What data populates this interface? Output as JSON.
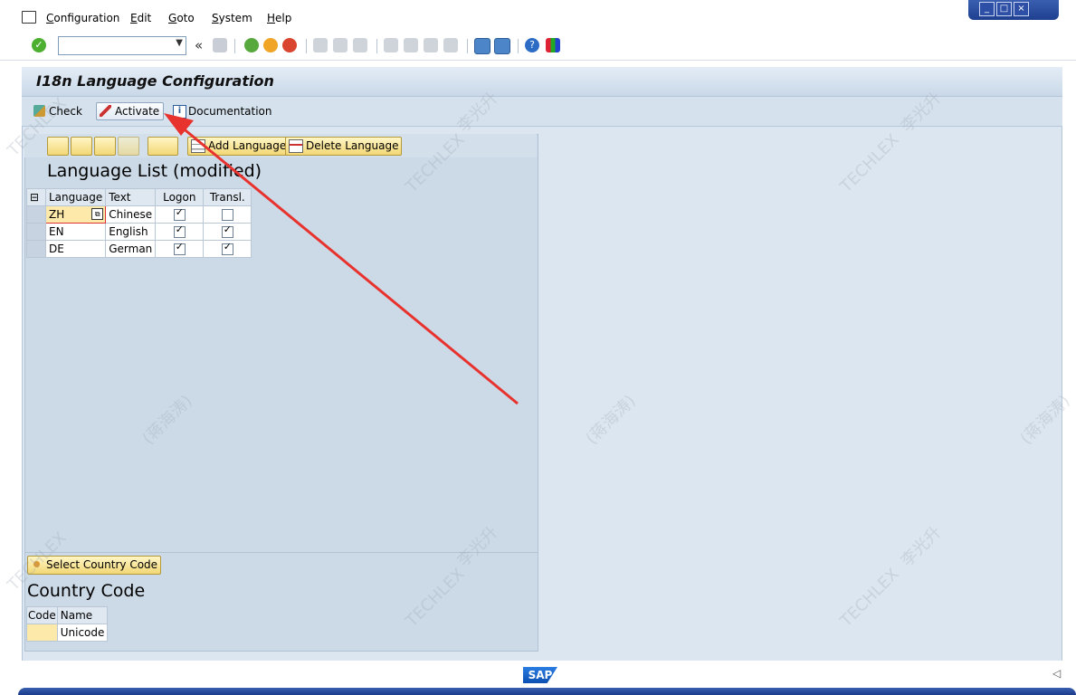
{
  "menu": {
    "items": [
      {
        "label": "Configuration"
      },
      {
        "label": "Edit"
      },
      {
        "label": "Goto"
      },
      {
        "label": "System"
      },
      {
        "label": "Help"
      }
    ]
  },
  "toolbar": {
    "command_value": "",
    "back_label": "«"
  },
  "screen": {
    "title": "I18n Language Configuration"
  },
  "app_toolbar": {
    "check_label": "Check",
    "activate_label": "Activate",
    "documentation_label": "Documentation"
  },
  "language_panel": {
    "add_label": "Add Language",
    "delete_label": "Delete Language",
    "heading": "Language List (modified)",
    "columns": [
      "Language",
      "Text",
      "Logon",
      "Transl."
    ],
    "rows": [
      {
        "code": "ZH",
        "text": "Chinese",
        "logon": true,
        "transl": false
      },
      {
        "code": "EN",
        "text": "English",
        "logon": true,
        "transl": true
      },
      {
        "code": "DE",
        "text": "German",
        "logon": true,
        "transl": true
      }
    ]
  },
  "country_panel": {
    "select_label": "Select Country Code",
    "heading": "Country Code",
    "columns": [
      "Code",
      "Name"
    ],
    "rows": [
      {
        "code": "",
        "name": "Unicode"
      }
    ]
  },
  "footer": {
    "logo_text": "SAP"
  },
  "colors": {
    "frame_bg": "#dbe6f0",
    "panel_bg": "#ccdae7",
    "button_yellow": "#f2d775",
    "arrow_red": "#e8322e",
    "window_blue": "#2d4fa5"
  }
}
